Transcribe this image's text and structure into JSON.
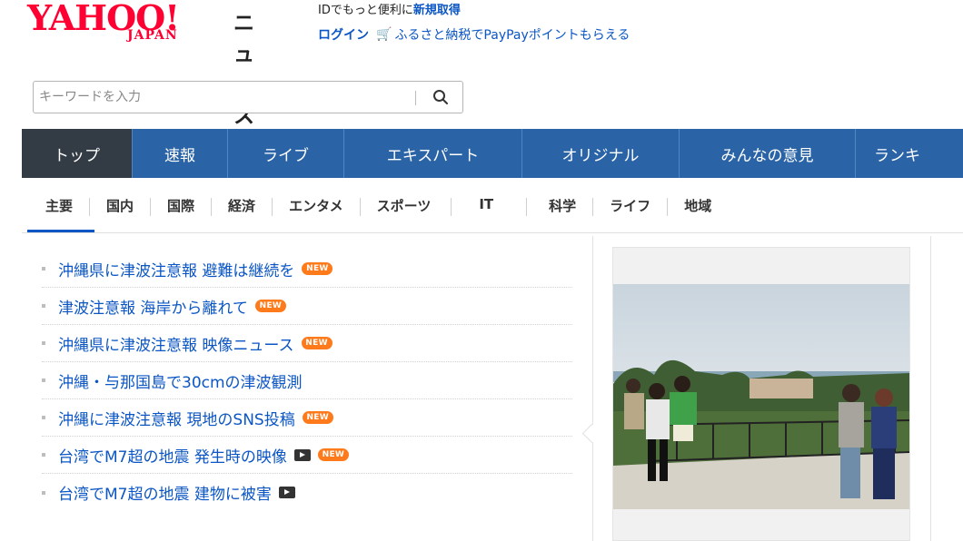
{
  "header": {
    "logo": {
      "yahoo": "YAHOO!",
      "japan": "JAPAN"
    },
    "service_name": "ニュース",
    "promo_text": "IDでもっと便利に",
    "promo_link": "新規取得",
    "login_link": "ログイン",
    "furusato_link": "ふるさと納税でPayPayポイントもらえる"
  },
  "search": {
    "placeholder": "キーワードを入力",
    "value": ""
  },
  "global_nav": [
    {
      "label": "トップ",
      "active": true
    },
    {
      "label": "速報"
    },
    {
      "label": "ライブ"
    },
    {
      "label": "エキスパート"
    },
    {
      "label": "オリジナル"
    },
    {
      "label": "みんなの意見"
    },
    {
      "label": "ランキ"
    }
  ],
  "category_nav": [
    {
      "label": "主要",
      "active": true
    },
    {
      "label": "国内"
    },
    {
      "label": "国際"
    },
    {
      "label": "経済"
    },
    {
      "label": "エンタメ"
    },
    {
      "label": "スポーツ"
    },
    {
      "label": "IT"
    },
    {
      "label": "科学"
    },
    {
      "label": "ライフ"
    },
    {
      "label": "地域"
    }
  ],
  "news": [
    {
      "title": "沖縄県に津波注意報 避難は継続を",
      "video": false,
      "new": true
    },
    {
      "title": "津波注意報 海岸から離れて",
      "video": false,
      "new": true
    },
    {
      "title": "沖縄県に津波注意報 映像ニュース",
      "video": false,
      "new": true
    },
    {
      "title": "沖縄・与那国島で30cmの津波観測",
      "video": false,
      "new": false
    },
    {
      "title": "沖縄に津波注意報 現地のSNS投稿",
      "video": false,
      "new": true
    },
    {
      "title": "台湾でM7超の地震 発生時の映像",
      "video": true,
      "new": true
    },
    {
      "title": "台湾でM7超の地震 建物に被害",
      "video": true,
      "new": false
    }
  ],
  "badge_text": "NEW",
  "colors": {
    "brand": "#ff0033",
    "link": "#0b56c4",
    "nav_bg": "#2b64a6",
    "nav_active": "#333b45",
    "new_badge": "#ff7a1a"
  },
  "icons": {
    "search": "search-icon",
    "video": "video-play-icon",
    "cart": "cart-icon"
  }
}
